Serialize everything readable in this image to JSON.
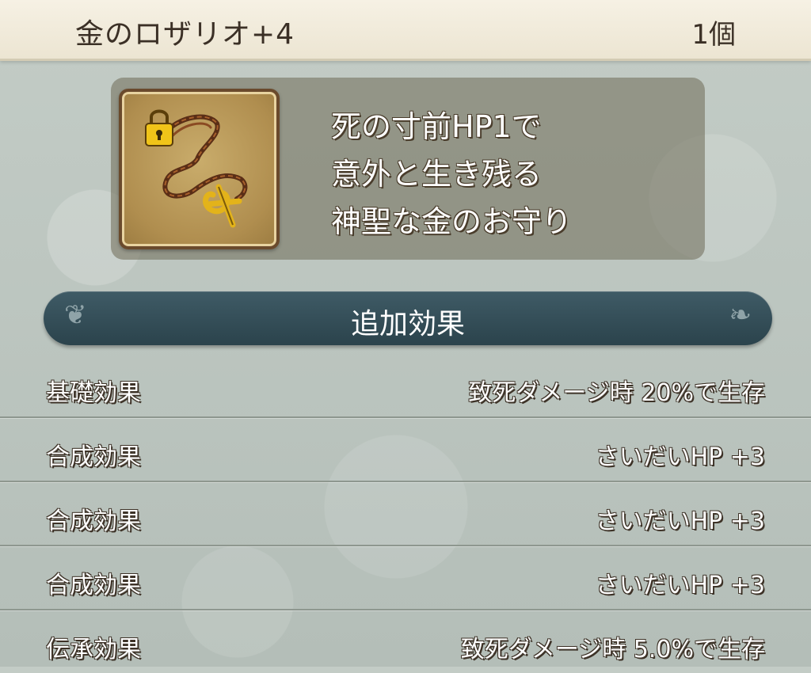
{
  "header": {
    "item_name": "金のロザリオ+4",
    "quantity": "1個"
  },
  "item": {
    "icon": "golden-rosary-icon",
    "description_lines": [
      "死の寸前HP1で",
      "意外と生き残る",
      "神聖な金のお守り"
    ]
  },
  "section": {
    "title": "追加効果"
  },
  "effects": [
    {
      "name": "基礎効果",
      "value": "致死ダメージ時 20%で生存"
    },
    {
      "name": "合成効果",
      "value": "さいだいHP +3"
    },
    {
      "name": "合成効果",
      "value": "さいだいHP +3"
    },
    {
      "name": "合成効果",
      "value": "さいだいHP +3"
    },
    {
      "name": "伝承効果",
      "value": "致死ダメージ時 5.0%で生存"
    }
  ],
  "colors": {
    "header_bg": "#f2ecdc",
    "section_bar": "#2f4a54",
    "icon_frame": "#b08e4f"
  }
}
